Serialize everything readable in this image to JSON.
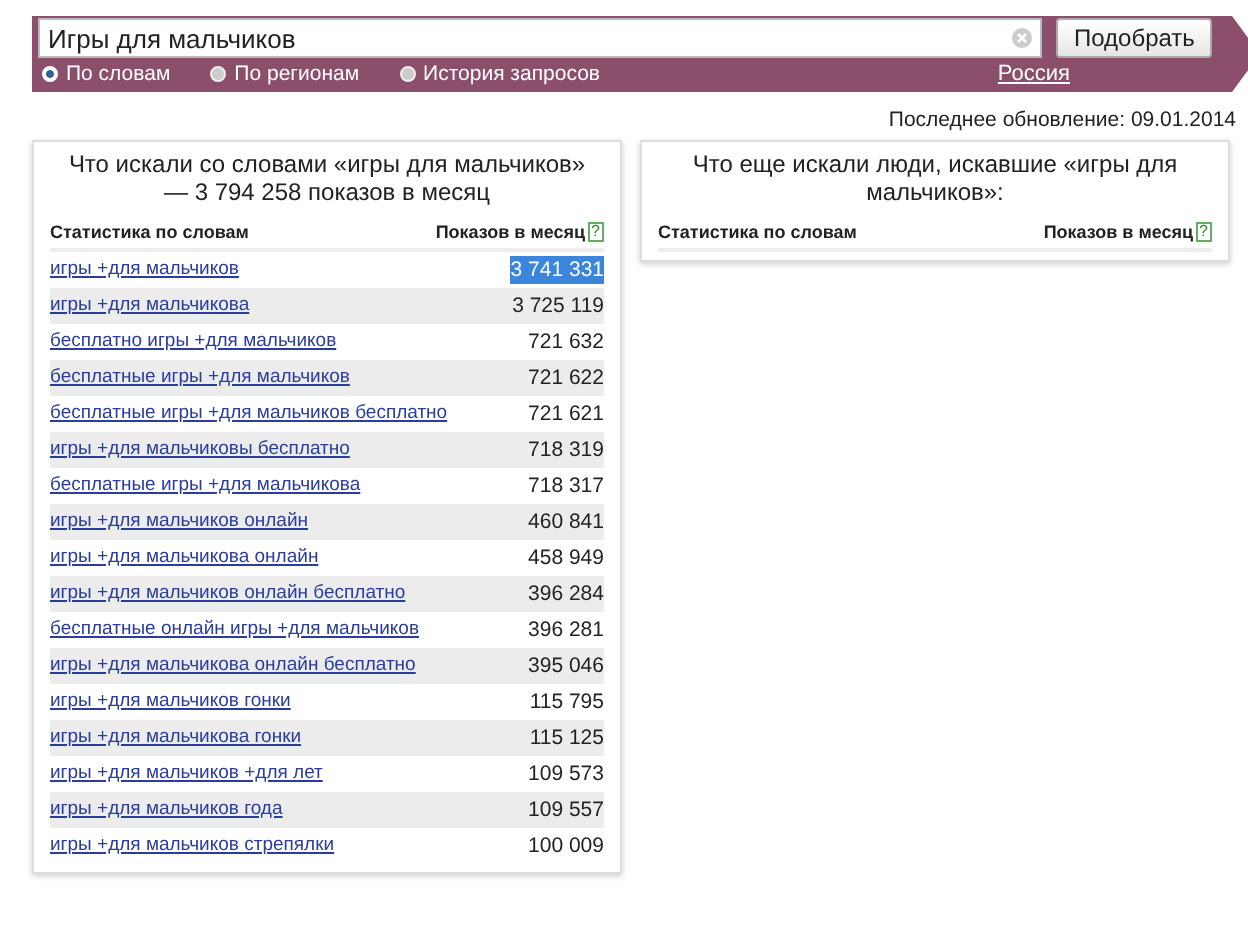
{
  "search": {
    "value": "Игры для мальчиков",
    "button": "Подобрать",
    "modes": [
      {
        "label": "По словам",
        "selected": true
      },
      {
        "label": "По регионам",
        "selected": false
      },
      {
        "label": "История запросов",
        "selected": false
      }
    ],
    "region": "Россия"
  },
  "updated": "Последнее обновление: 09.01.2014",
  "left_panel": {
    "title": "Что искали со словами «игры для мальчиков» — 3 794 258 показов в месяц",
    "columns": [
      "Статистика по словам",
      "Показов в месяц"
    ],
    "help": "?",
    "rows": [
      {
        "phrase": "игры +для мальчиков",
        "count": "3 741 331",
        "highlighted": true
      },
      {
        "phrase": "игры +для мальчикова",
        "count": "3 725 119",
        "highlighted": false
      },
      {
        "phrase": "бесплатно игры +для мальчиков",
        "count": "721 632",
        "highlighted": false
      },
      {
        "phrase": "бесплатные игры +для мальчиков",
        "count": "721 622",
        "highlighted": false
      },
      {
        "phrase": "бесплатные игры +для мальчиков бесплатно",
        "count": "721 621",
        "highlighted": false
      },
      {
        "phrase": "игры +для мальчиковы бесплатно",
        "count": "718 319",
        "highlighted": false
      },
      {
        "phrase": "бесплатные игры +для мальчикова",
        "count": "718 317",
        "highlighted": false
      },
      {
        "phrase": "игры +для мальчиков онлайн",
        "count": "460 841",
        "highlighted": false
      },
      {
        "phrase": "игры +для мальчикова онлайн",
        "count": "458 949",
        "highlighted": false
      },
      {
        "phrase": "игры +для мальчиков онлайн бесплатно",
        "count": "396 284",
        "highlighted": false
      },
      {
        "phrase": "бесплатные онлайн игры +для мальчиков",
        "count": "396 281",
        "highlighted": false
      },
      {
        "phrase": "игры +для мальчикова онлайн бесплатно",
        "count": "395 046",
        "highlighted": false
      },
      {
        "phrase": "игры +для мальчиков гонки",
        "count": "115 795",
        "highlighted": false
      },
      {
        "phrase": "игры +для мальчикова гонки",
        "count": "115 125",
        "highlighted": false
      },
      {
        "phrase": "игры +для мальчиков +для лет",
        "count": "109 573",
        "highlighted": false
      },
      {
        "phrase": "игры +для мальчиков года",
        "count": "109 557",
        "highlighted": false
      },
      {
        "phrase": "игры +для мальчиков стрепялки",
        "count": "100 009",
        "highlighted": false
      }
    ]
  },
  "right_panel": {
    "title": "Что еще искали люди, искавшие «игры для мальчиков»:",
    "columns": [
      "Статистика по словам",
      "Показов в месяц"
    ],
    "help": "?"
  }
}
